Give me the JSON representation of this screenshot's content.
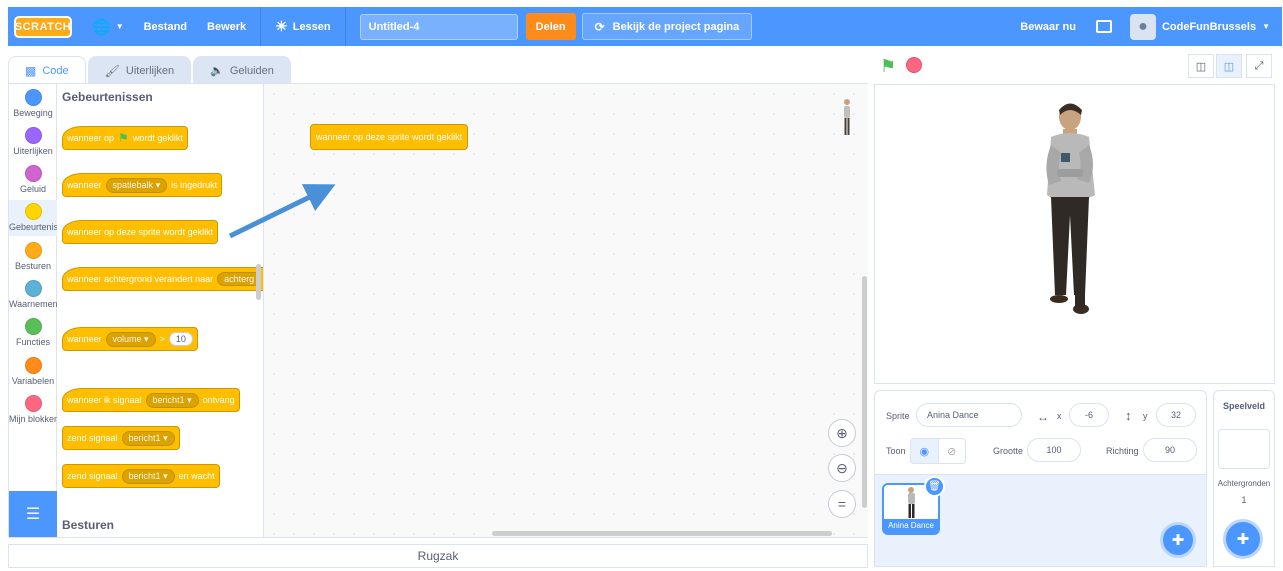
{
  "menubar": {
    "logo": "SCRATCH",
    "file": "Bestand",
    "edit": "Bewerk",
    "tutorials": "Lessen",
    "project_title": "Untitled-4",
    "share": "Delen",
    "see_project_page": "Bekijk de project pagina",
    "save_now": "Bewaar nu",
    "username": "CodeFunBrussels"
  },
  "tabs": {
    "code": "Code",
    "costumes": "Uiterlijken",
    "sounds": "Geluiden"
  },
  "categories": [
    {
      "label": "Beweging",
      "color": "#4c97ff"
    },
    {
      "label": "Uiterlijken",
      "color": "#9966ff"
    },
    {
      "label": "Geluid",
      "color": "#cf63cf"
    },
    {
      "label": "Gebeurtenissen",
      "color": "#ffd500"
    },
    {
      "label": "Besturen",
      "color": "#ffab19"
    },
    {
      "label": "Waarnemen",
      "color": "#5cb1d6"
    },
    {
      "label": "Functies",
      "color": "#59c059"
    },
    {
      "label": "Variabelen",
      "color": "#ff8c1a"
    },
    {
      "label": "Mijn blokken",
      "color": "#ff6680"
    }
  ],
  "palette": {
    "heading_events": "Gebeurtenissen",
    "heading_control": "Besturen",
    "when_flag_a": "wanneer op",
    "when_flag_b": "wordt geklikt",
    "when_key_a": "wanneer",
    "when_key_key": "spatiebalk",
    "when_key_b": "is ingedrukt",
    "when_sprite_clicked": "wanneer op deze sprite wordt geklikt",
    "when_backdrop_a": "wanneer achtergrond verandert naar",
    "when_backdrop_value": "achterg",
    "when_gt_a": "wanneer",
    "when_gt_sensor": "volume",
    "when_gt_op": ">",
    "when_gt_value": "10",
    "when_receive_a": "wanneer ik signaal",
    "when_receive_msg": "bericht1",
    "when_receive_b": "ontvang",
    "broadcast_a": "zend signaal",
    "broadcast_msg": "bericht1",
    "broadcast_wait_a": "zend signaal",
    "broadcast_wait_msg": "bericht1",
    "broadcast_wait_b": "en wacht"
  },
  "script_area": {
    "block_text": "wanneer op deze sprite wordt geklikt"
  },
  "backpack": "Rugzak",
  "sprite_info": {
    "sprite_label": "Sprite",
    "sprite_name": "Anina Dance",
    "x_label": "x",
    "x_value": "-6",
    "y_label": "y",
    "y_value": "32",
    "show_label": "Toon",
    "size_label": "Grootte",
    "size_value": "100",
    "direction_label": "Richting",
    "direction_value": "90"
  },
  "sprite_list": [
    {
      "name": "Anina Dance"
    }
  ],
  "stage_pane": {
    "title": "Speelveld",
    "backdrops_label": "Achtergronden",
    "backdrops_count": "1"
  },
  "icons": {
    "globe": "globe-icon",
    "tutorials": "lightbulb-icon",
    "folder": "folder-icon",
    "green_flag": "green-flag-icon",
    "stop": "stop-icon",
    "zoom_in": "zoom-in-icon",
    "zoom_out": "zoom-out-icon",
    "zoom_reset": "zoom-reset-icon"
  },
  "colors": {
    "menubar": "#4c97ff",
    "share": "#ff8c1a",
    "events_block": "#ffbf00",
    "annotation_arrow": "#4a90d9"
  }
}
